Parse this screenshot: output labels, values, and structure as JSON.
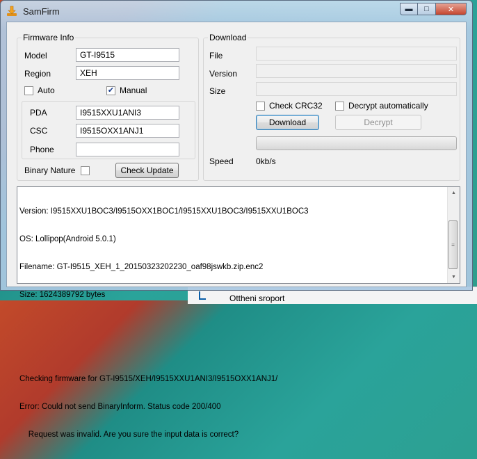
{
  "window": {
    "title": "SamFirm"
  },
  "window_buttons": {
    "minimize": "▬",
    "maximize": "□",
    "close": "✕"
  },
  "firmware_info": {
    "group_label": "Firmware Info",
    "model": {
      "label": "Model",
      "value": "GT-I9515"
    },
    "region": {
      "label": "Region",
      "value": "XEH"
    },
    "auto": {
      "label": "Auto",
      "checked": false
    },
    "manual": {
      "label": "Manual",
      "checked": true
    },
    "pda": {
      "label": "PDA",
      "value": "I9515XXU1ANI3"
    },
    "csc": {
      "label": "CSC",
      "value": "I9515OXX1ANJ1"
    },
    "phone": {
      "label": "Phone",
      "value": ""
    },
    "binary_nature": {
      "label": "Binary Nature",
      "checked": false
    },
    "check_update_label": "Check Update"
  },
  "download": {
    "group_label": "Download",
    "file_label": "File",
    "version_label": "Version",
    "size_label": "Size",
    "check_crc32": {
      "label": "Check CRC32",
      "checked": false
    },
    "decrypt_automatically": {
      "label": "Decrypt automatically",
      "checked": false
    },
    "download_button": "Download",
    "decrypt_button": "Decrypt",
    "progress": 0,
    "speed_label": "Speed",
    "speed_value": "0kb/s"
  },
  "log": {
    "lines": [
      "Version: I9515XXU1BOC3/I9515OXX1BOC1/I9515XXU1BOC3/I9515XXU1BOC3",
      "OS: Lollipop(Android 5.0.1)",
      "Filename: GT-I9515_XEH_1_20150323202230_oaf98jswkb.zip.enc2",
      "Size: 1624389792 bytes",
      "",
      "",
      "Checking firmware for GT-I9515/XEH/I9515XXU1ANI3/I9515OXX1ANJ1/",
      "Error: Could not send BinaryInform. Status code 200/400",
      "    Request was invalid. Are you sure the input data is correct?"
    ]
  },
  "background_window": {
    "text": "Ottheni sroport"
  },
  "colors": {
    "accent": "#3c7fb1",
    "title_bar": "#b9d1ea",
    "close_button": "#c4452f"
  }
}
